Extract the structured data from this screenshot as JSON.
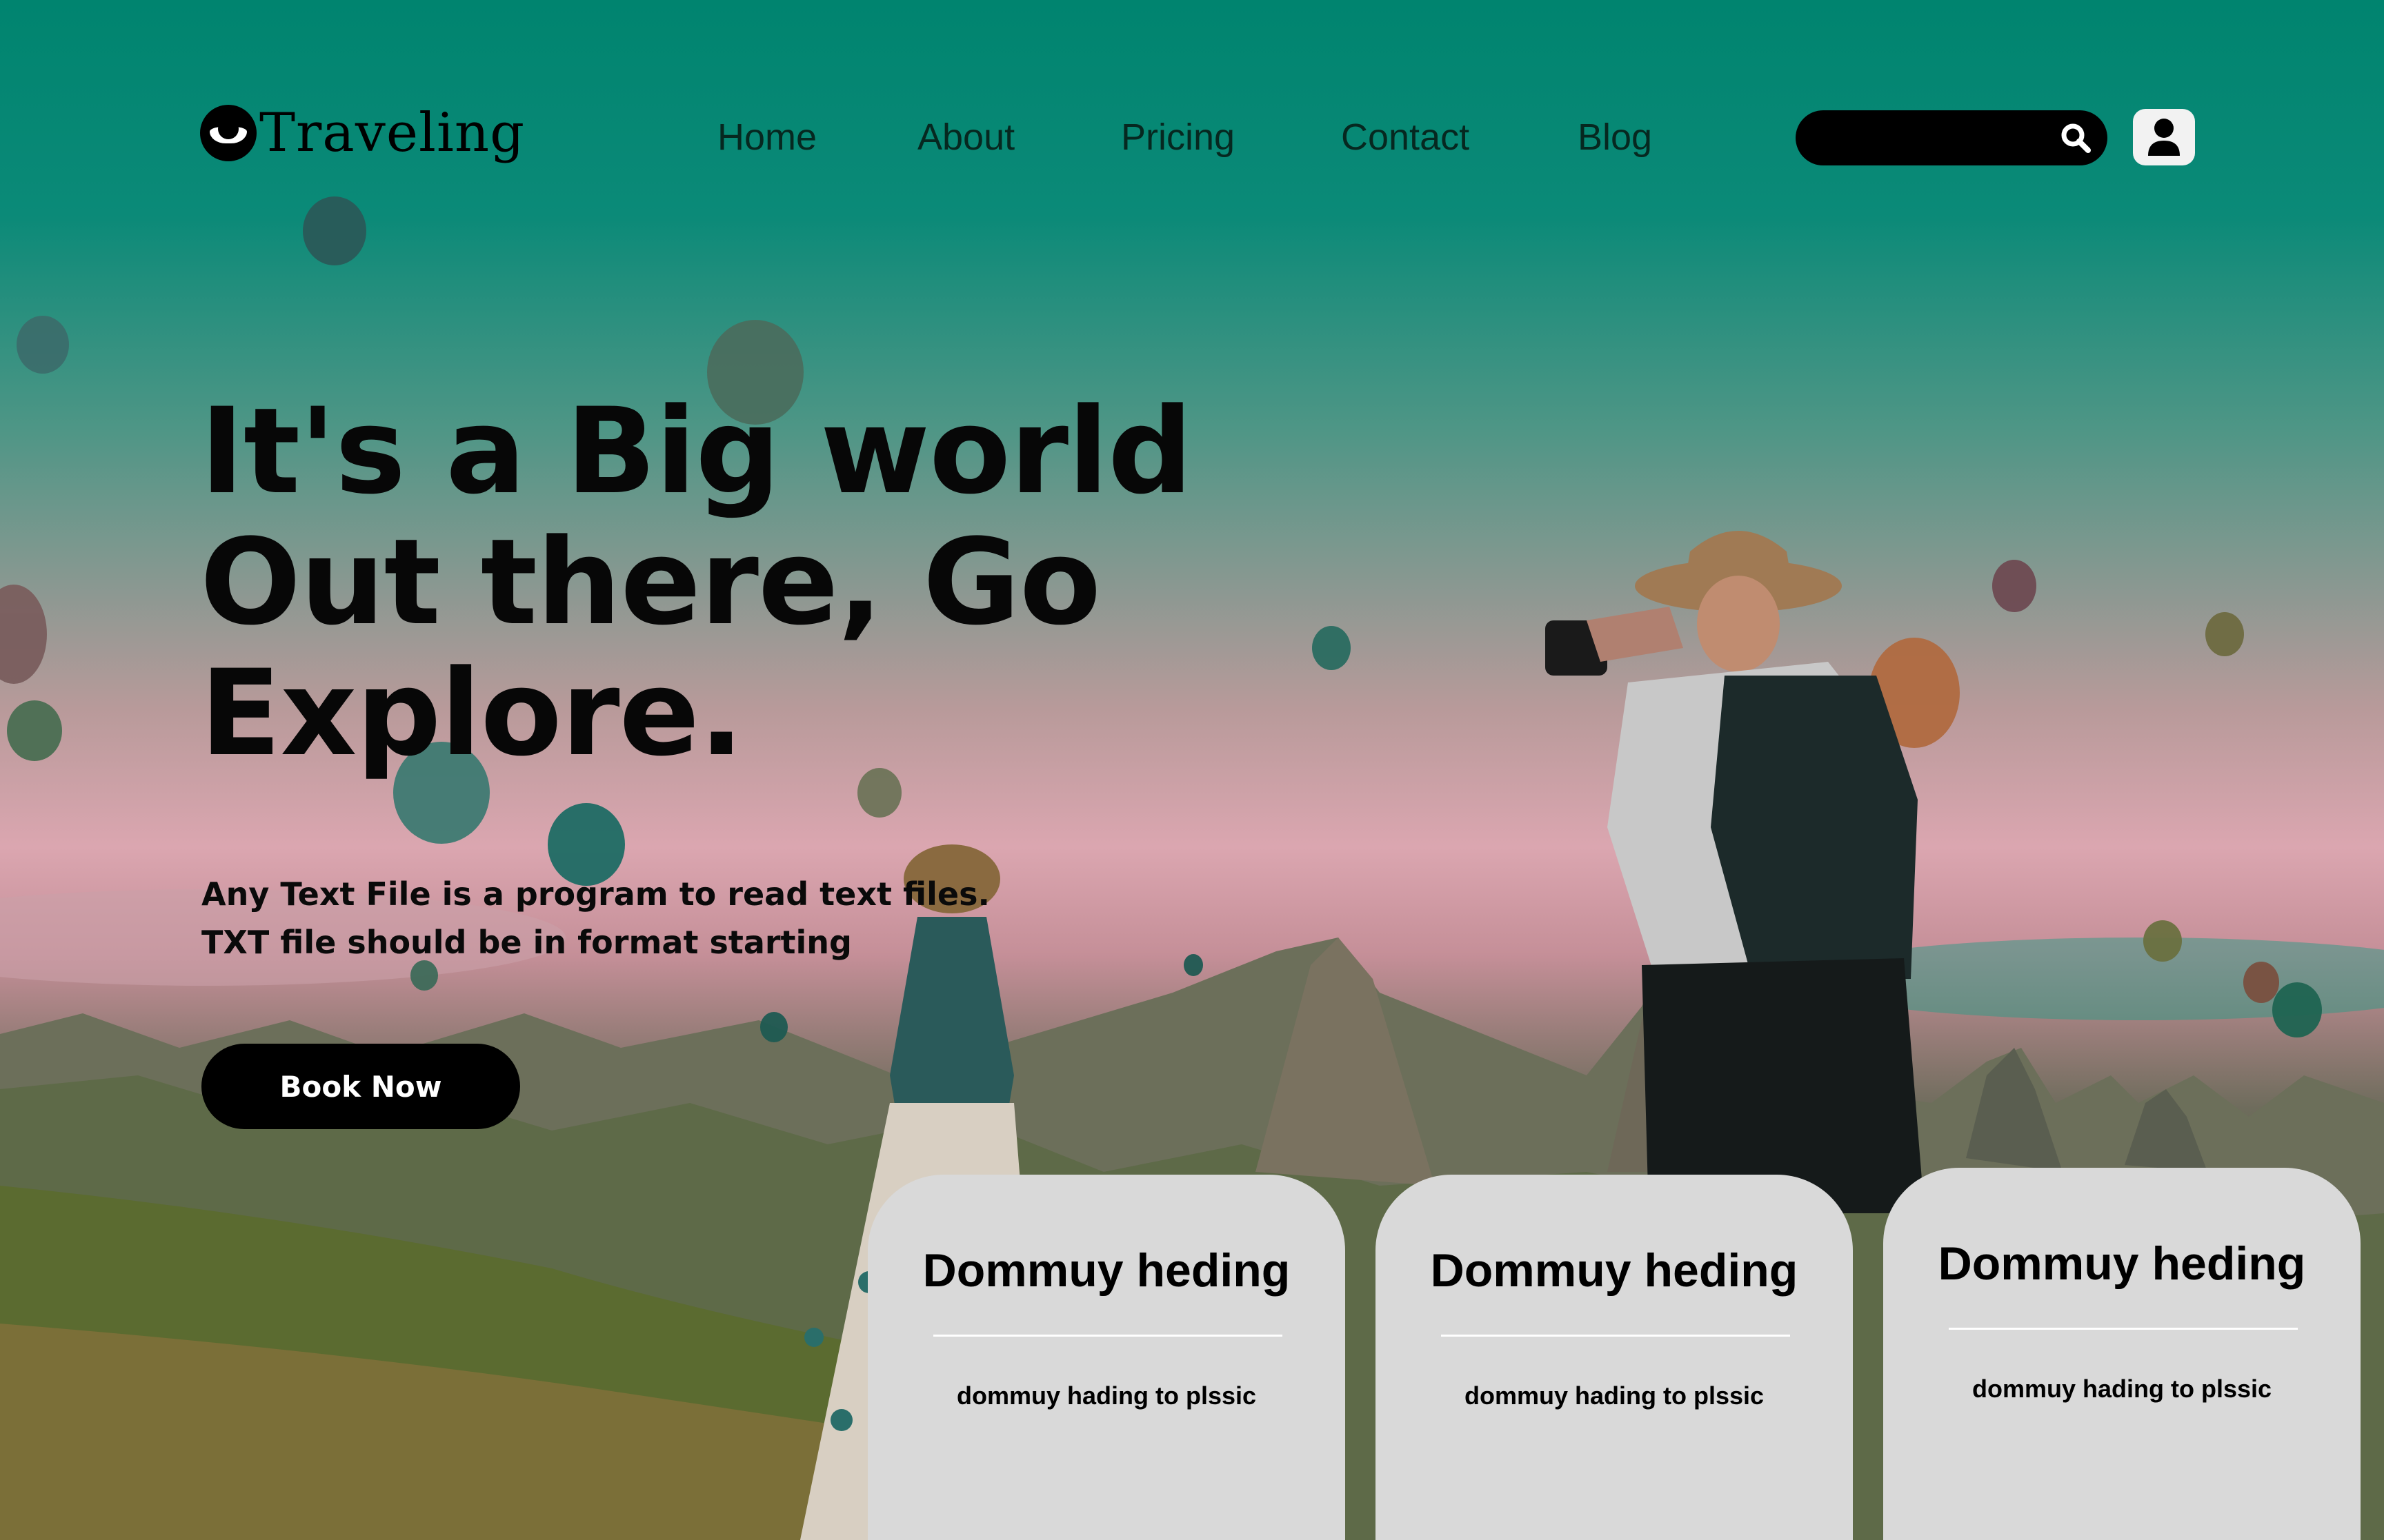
{
  "brand": {
    "name": "Traveling",
    "logo_icon": "eye-logo-icon"
  },
  "nav": {
    "items": [
      {
        "label": "Home"
      },
      {
        "label": "About"
      },
      {
        "label": "Pricing"
      },
      {
        "label": "Contact"
      },
      {
        "label": "Blog"
      }
    ]
  },
  "search": {
    "placeholder": "",
    "icon": "search-icon"
  },
  "account": {
    "icon": "user-icon"
  },
  "hero": {
    "title_lines": [
      "It's a Big world",
      "Out there, Go",
      "Explore."
    ],
    "subtitle_lines": [
      "Any Text File is a program to read text files.",
      "TXT file should be in format starting"
    ],
    "cta_label": "Book Now"
  },
  "cards": [
    {
      "title": "Dommuy heding",
      "text": "dommuy hading to plssic"
    },
    {
      "title": "Dommuy heding",
      "text": "dommuy hading to plssic"
    },
    {
      "title": "Dommuy heding",
      "text": "dommuy hading to plssic"
    }
  ],
  "colors": {
    "sky_top": "#00846f",
    "sky_mid": "#dba6b0",
    "button_bg": "#000000",
    "card_bg": "#d9d9d9"
  }
}
